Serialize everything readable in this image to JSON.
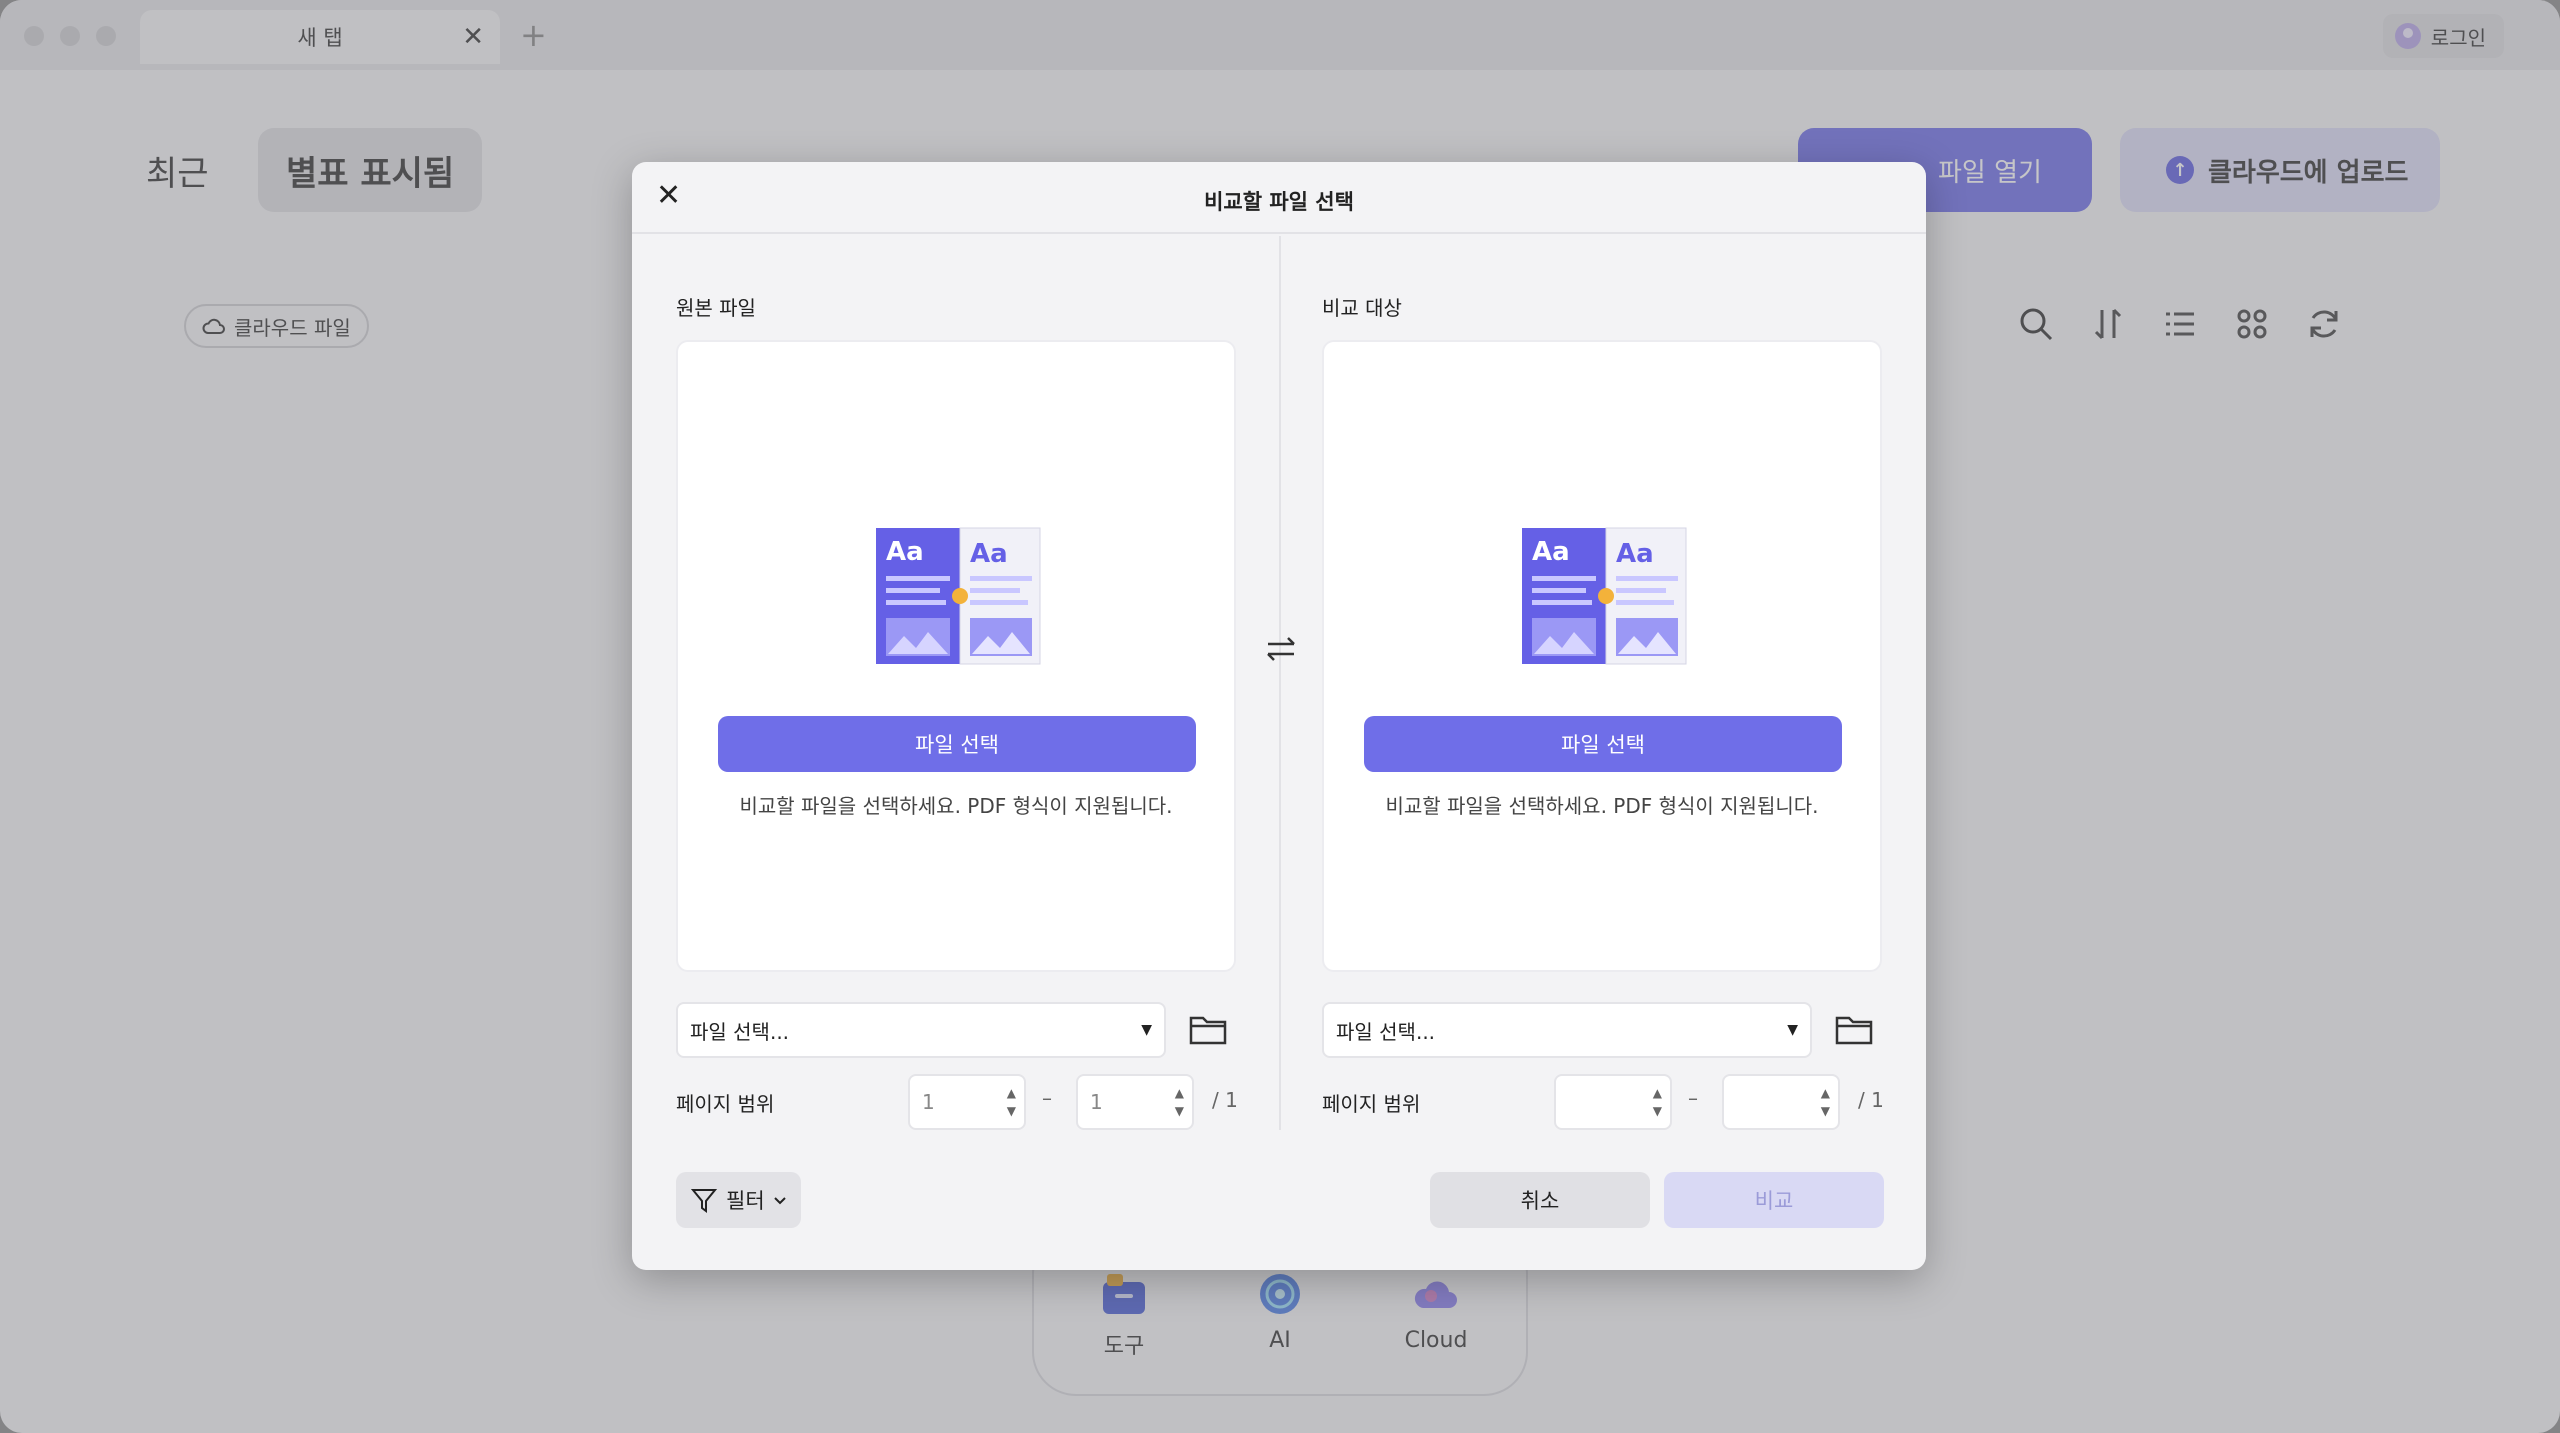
{
  "titlebar": {
    "tab_label": "새 탭",
    "tab_close": "✕",
    "tab_add": "+",
    "login_label": "로그인"
  },
  "background": {
    "nav_recent": "최근",
    "nav_starred": "별표 표시됨",
    "cloud_files": "클라우드 파일",
    "open_file": "파일 열기",
    "upload": "클라우드에 업로드",
    "toolbar_icons": [
      "search-icon",
      "sort-icon",
      "list-view-icon",
      "grid-view-icon",
      "refresh-icon"
    ]
  },
  "dock": {
    "items": [
      {
        "label": "도구",
        "icon": "tools-icon"
      },
      {
        "label": "AI",
        "icon": "ai-icon"
      },
      {
        "label": "Cloud",
        "icon": "cloud-icon"
      }
    ]
  },
  "modal": {
    "title": "비교할 파일 선택",
    "close": "✕",
    "left": {
      "label": "원본 파일",
      "select_button": "파일 선택",
      "hint": "비교할 파일을 선택하세요. PDF 형식이 지원됩니다.",
      "dropdown_value": "파일 선택...",
      "range_label": "페이지 범위",
      "range_from": "1",
      "range_to": "1",
      "range_dash": "–",
      "range_total": "/ 1"
    },
    "right": {
      "label": "비교 대상",
      "select_button": "파일 선택",
      "hint": "비교할 파일을 선택하세요. PDF 형식이 지원됩니다.",
      "dropdown_value": "파일 선택...",
      "range_label": "페이지 범위",
      "range_from": "",
      "range_to": "",
      "range_dash": "–",
      "range_total": "/ 1"
    },
    "filter_label": "필터",
    "cancel_label": "취소",
    "compare_label": "비교"
  },
  "colors": {
    "accent": "#6f6ee8",
    "accent_disabled": "#d9d9f4"
  }
}
